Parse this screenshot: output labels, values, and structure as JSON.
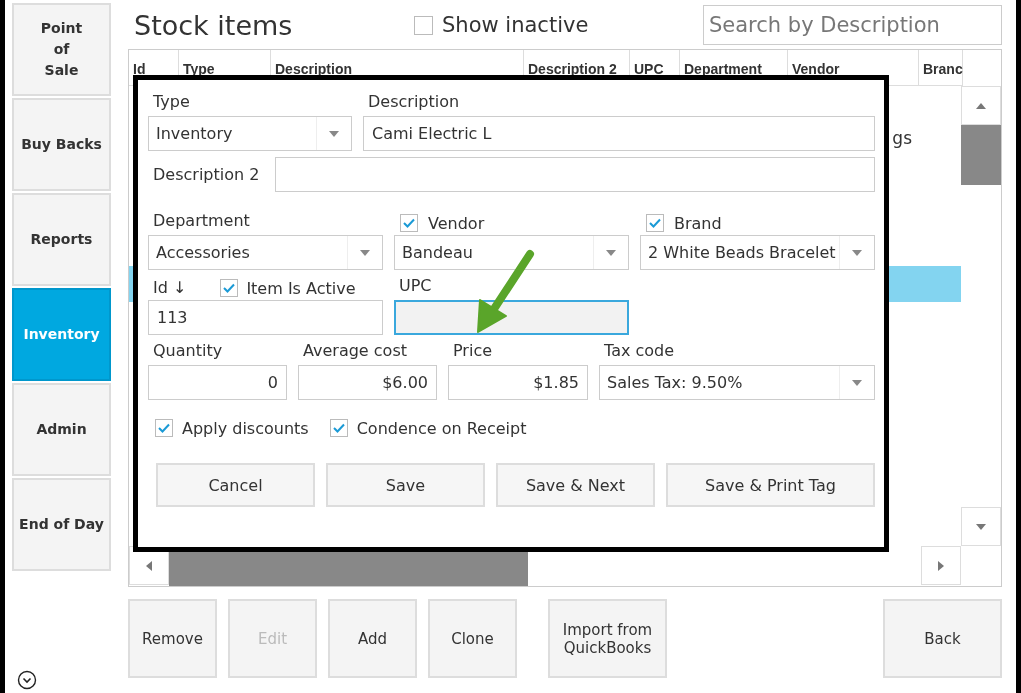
{
  "sidebar": {
    "items": [
      {
        "label": "Point\nof\nSale",
        "selected": false
      },
      {
        "label": "Buy Backs",
        "selected": false
      },
      {
        "label": "Reports",
        "selected": false
      },
      {
        "label": "Inventory",
        "selected": true
      },
      {
        "label": "Admin",
        "selected": false
      },
      {
        "label": "End of Day",
        "selected": false
      }
    ]
  },
  "title": "Stock items",
  "show_inactive": {
    "label": "Show inactive",
    "checked": false
  },
  "search": {
    "placeholder": "Search by Description"
  },
  "table": {
    "columns": [
      "Id",
      "Type",
      "Description",
      "Description 2",
      "UPC",
      "Department",
      "Vendor",
      "Branc"
    ],
    "rows": [
      {
        "selected": false
      },
      {
        "vendor": "gs",
        "selected": false
      },
      {
        "selected": false
      },
      {
        "selected": false
      },
      {
        "selected": false
      },
      {
        "selected": true
      }
    ]
  },
  "dialog": {
    "type": {
      "label": "Type",
      "value": "Inventory"
    },
    "description": {
      "label": "Description",
      "value": "Cami Electric L"
    },
    "description_2": {
      "label": "Description 2"
    },
    "department": {
      "label": "Department",
      "value": "Accessories"
    },
    "vendor": {
      "label": "Vendor",
      "checked": true,
      "value": "Bandeau"
    },
    "brand": {
      "label": "Brand",
      "checked": true,
      "value": "2 White Beads Bracelet"
    },
    "id": {
      "label": "Id ↓",
      "value": "113"
    },
    "item_is_active": {
      "label": "Item Is Active",
      "checked": true
    },
    "upc": {
      "label": "UPC",
      "focused": true
    },
    "quantity": {
      "label": "Quantity",
      "value": "0"
    },
    "average_cost": {
      "label": "Average cost",
      "value": "$6.00"
    },
    "price": {
      "label": "Price",
      "value": "$1.85"
    },
    "tax_code": {
      "label": "Tax code",
      "value": "Sales Tax: 9.50%"
    },
    "options": [
      {
        "label": "Apply discounts",
        "checked": true
      },
      {
        "label": "Condence on Receipt",
        "checked": true
      }
    ],
    "buttons": [
      "Cancel",
      "Save",
      "Save & Next",
      "Save & Print Tag"
    ]
  },
  "actions": [
    {
      "label": "Remove",
      "disabled": false
    },
    {
      "label": "Edit",
      "disabled": true
    },
    {
      "label": "Add",
      "disabled": false
    },
    {
      "label": "Clone",
      "disabled": false
    },
    {
      "label": "Import from\nQuickBooks",
      "disabled": false
    },
    {
      "label": "Back",
      "disabled": false
    }
  ]
}
